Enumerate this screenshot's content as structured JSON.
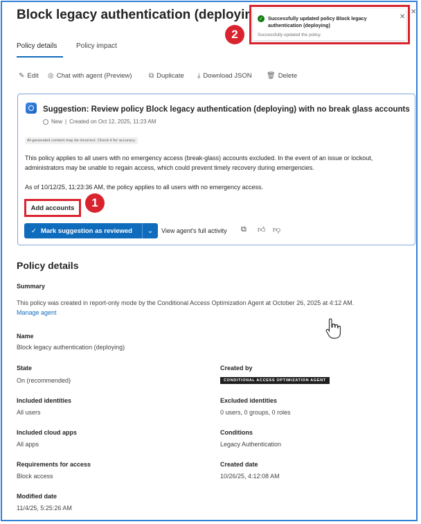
{
  "header": {
    "title": "Block legacy authentication (deploying)"
  },
  "tabs": [
    {
      "label": "Policy details",
      "active": true
    },
    {
      "label": "Policy impact",
      "active": false
    }
  ],
  "toolbar": {
    "edit": "Edit",
    "chat": "Chat with agent (Preview)",
    "duplicate": "Duplicate",
    "download": "Download JSON",
    "delete": "Delete"
  },
  "suggestion": {
    "title": "Suggestion: Review policy Block legacy authentication (deploying) with no break glass accounts",
    "status": "New",
    "created": "Created on Oct 12, 2025, 11:23 AM",
    "ai_notice": "AI-generated content may be incorrect. Check it for accuracy.",
    "description": "This policy applies to all users with no emergency access (break-glass) accounts excluded. In the event of an issue or lockout, administrators may be unable to regain access, which could prevent timely recovery during emergencies.",
    "as_of": "As of 10/12/25, 11:23:36 AM, the policy applies to all users with no emergency access.",
    "add_accounts": "Add accounts",
    "mark_reviewed": "Mark suggestion as reviewed",
    "view_activity": "View agent's full activity"
  },
  "annotations": {
    "one": "1",
    "two": "2"
  },
  "details": {
    "section_title": "Policy details",
    "summary_label": "Summary",
    "summary_text": "This policy was created in report-only mode by the Conditional Access Optimization Agent at October 26, 2025 at 4:12 AM.",
    "manage_agent": "Manage agent",
    "name_label": "Name",
    "name_value": "Block legacy authentication (deploying)",
    "state_label": "State",
    "state_value": "On (recommended)",
    "created_by_label": "Created by",
    "created_by_value": "CONDITIONAL ACCESS OPTIMIZATION AGENT",
    "included_identities_label": "Included identities",
    "included_identities_value": "All users",
    "excluded_identities_label": "Excluded identities",
    "excluded_identities_value": "0 users, 0 groups, 0 roles",
    "included_apps_label": "Included cloud apps",
    "included_apps_value": "All apps",
    "conditions_label": "Conditions",
    "conditions_value": "Legacy Authentication",
    "requirements_label": "Requirements for access",
    "requirements_value": "Block access",
    "created_date_label": "Created date",
    "created_date_value": "10/26/25, 4:12:08 AM",
    "modified_date_label": "Modified date",
    "modified_date_value": "11/4/25, 5:25:26 AM"
  },
  "toast": {
    "title": "Successfully updated policy Block legacy authentication (deploying)",
    "subtitle": "Successfully updated the policy."
  },
  "colors": {
    "accent": "#0f6cbd",
    "annotation_red": "#d9232e",
    "success": "#107c10",
    "frame_blue": "#2f7fd6"
  }
}
